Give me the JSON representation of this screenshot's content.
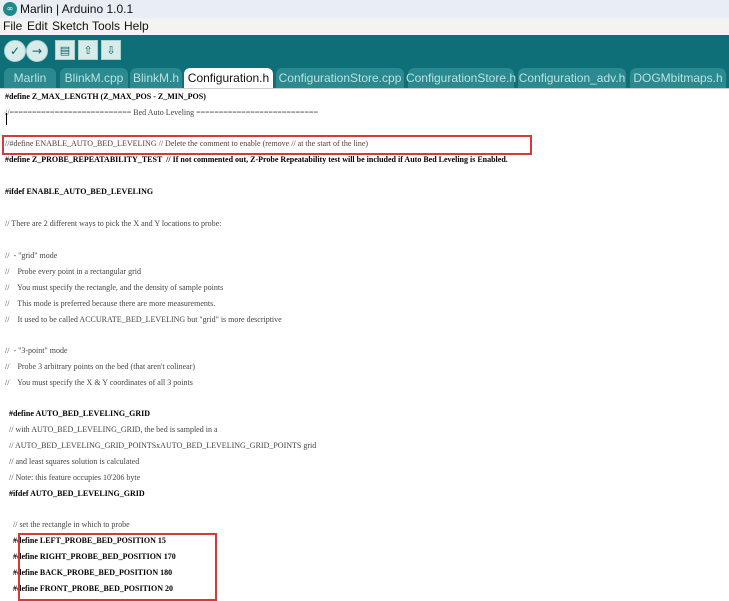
{
  "window": {
    "title": "Marlin | Arduino 1.0.1"
  },
  "menu": [
    "File",
    "Edit",
    "Sketch",
    "Tools",
    "Help"
  ],
  "toolbar_icons": [
    "verify-icon",
    "upload-icon",
    "new-file-icon",
    "open-file-icon",
    "save-file-icon"
  ],
  "tabs": [
    "Marlin",
    "BlinkM.cpp",
    "BlinkM.h",
    "Configuration.h",
    "ConfigurationStore.cpp",
    "ConfigurationStore.h",
    "Configuration_adv.h",
    "DOGMbitmaps.h"
  ],
  "active_tab": "Configuration.h",
  "code_lines": [
    "#define Z_MAX_LENGTH (Z_MAX_POS - Z_MIN_POS)",
    "//=========================== Bed Auto Leveling ===========================",
    "",
    "//#define ENABLE_AUTO_BED_LEVELING // Delete the comment to enable (remove // at the start of the line)",
    "#define Z_PROBE_REPEATABILITY_TEST  // If not commented out, Z-Probe Repeatability test will be included if Auto Bed Leveling is Enabled.",
    "",
    "#ifdef ENABLE_AUTO_BED_LEVELING",
    "",
    "// There are 2 different ways to pick the X and Y locations to probe:",
    "",
    "//  - \"grid\" mode",
    "//    Probe every point in a rectangular grid",
    "//    You must specify the rectangle, and the density of sample points",
    "//    This mode is preferred because there are more measurements.",
    "//    It used to be called ACCURATE_BED_LEVELING but \"grid\" is more descriptive",
    "",
    "//  - \"3-point\" mode",
    "//    Probe 3 arbitrary points on the bed (that aren't colinear)",
    "//    You must specify the X & Y coordinates of all 3 points",
    "",
    "  #define AUTO_BED_LEVELING_GRID",
    "  // with AUTO_BED_LEVELING_GRID, the bed is sampled in a",
    "  // AUTO_BED_LEVELING_GRID_POINTSxAUTO_BED_LEVELING_GRID_POINTS grid",
    "  // and least squares solution is calculated",
    "  // Note: this feature occupies 10'206 byte",
    "  #ifdef AUTO_BED_LEVELING_GRID",
    "",
    "    // set the rectangle in which to probe",
    "    #define LEFT_PROBE_BED_POSITION 15",
    "    #define RIGHT_PROBE_BED_POSITION 170",
    "    #define BACK_PROBE_BED_POSITION 180",
    "    #define FRONT_PROBE_BED_POSITION 20"
  ]
}
